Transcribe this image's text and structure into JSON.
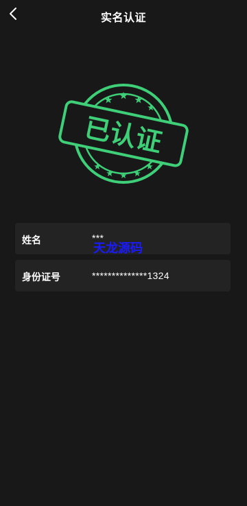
{
  "header": {
    "title": "实名认证",
    "back_icon": "chevron-left-icon"
  },
  "stamp": {
    "text": "已认证",
    "color": "#3ecf78"
  },
  "fields": {
    "name_label": "姓名",
    "name_value": "***",
    "id_label": "身份证号",
    "id_value": "**************1324"
  },
  "watermark": {
    "text": "天龙源码",
    "color": "#1a1aff"
  }
}
